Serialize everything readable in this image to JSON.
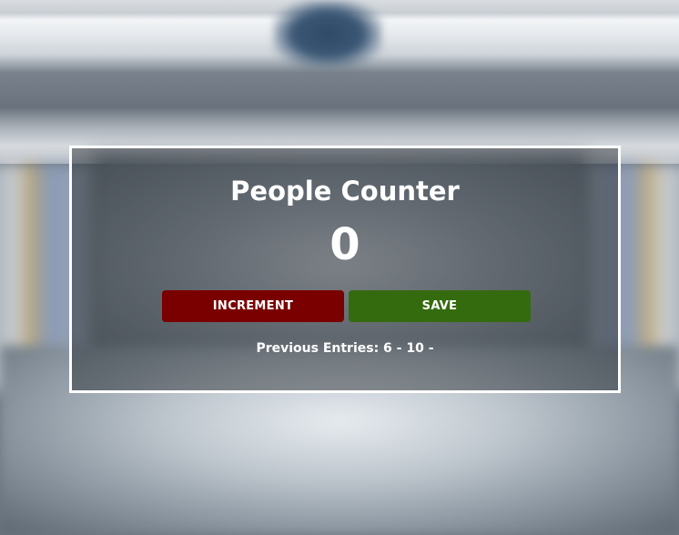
{
  "counter": {
    "title": "People Counter",
    "count": "0",
    "increment_label": "INCREMENT",
    "save_label": "SAVE",
    "entries_text": "Previous Entries: 6 - 10 -"
  },
  "colors": {
    "increment_button": "#7a0000",
    "save_button": "#356b0f",
    "panel_border": "#ffffff",
    "text": "#ffffff"
  }
}
